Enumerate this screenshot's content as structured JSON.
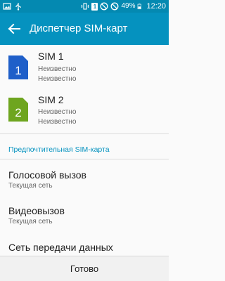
{
  "status_bar": {
    "sim_number": "1",
    "battery_percent": "49%",
    "time": "12:20",
    "icons": [
      "image-icon",
      "usb-icon",
      "vibrate-icon",
      "sim-icon",
      "no-entry-icon",
      "no-signal-icon",
      "battery-icon"
    ]
  },
  "app_bar": {
    "title": "Диспетчер SIM-карт",
    "back_icon": "arrow-left-icon"
  },
  "sims": [
    {
      "name": "SIM 1",
      "slot": "1",
      "line1": "Неизвестно",
      "line2": "Неизвестно",
      "color": "#1f5fc9",
      "icon": "sim-card-icon"
    },
    {
      "name": "SIM 2",
      "slot": "2",
      "line1": "Неизвестно",
      "line2": "Неизвестно",
      "color": "#6ea51f",
      "icon": "sim-card-icon"
    }
  ],
  "preferred": {
    "header": "Предпочтительная SIM-карта",
    "items": [
      {
        "title": "Голосовой вызов",
        "subtitle": "Текущая сеть"
      },
      {
        "title": "Видеовызов",
        "subtitle": "Текущая сеть"
      },
      {
        "title": "Сеть передачи данных"
      }
    ]
  },
  "footer": {
    "done_label": "Готово"
  },
  "colors": {
    "status_bar": "#0489b1",
    "app_bar": "#0592bf",
    "accent": "#0592bf"
  }
}
